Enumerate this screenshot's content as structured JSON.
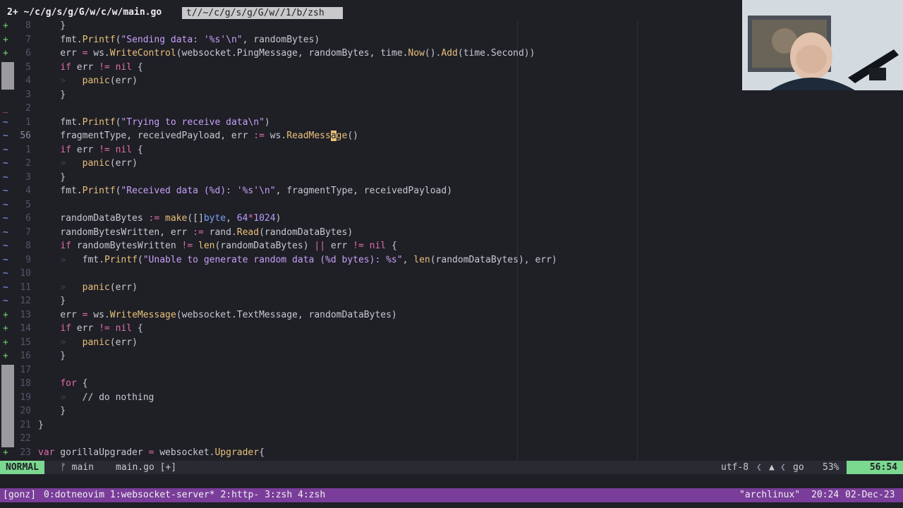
{
  "tabline": {
    "active": "2+ ~/c/g/s/g/G/w/c/w/main.go",
    "inactive": "t//~/c/g/s/g/G/w//1/b/zsh"
  },
  "lines": [
    {
      "sign": "+",
      "nr": "8",
      "code": [
        {
          "t": "    }",
          "c": "p"
        }
      ]
    },
    {
      "sign": "+",
      "nr": "7",
      "code": [
        {
          "t": "    fmt.",
          "c": "v"
        },
        {
          "t": "Printf",
          "c": "f"
        },
        {
          "t": "(",
          "c": "p"
        },
        {
          "t": "\"Sending data: '%s'\\n\"",
          "c": "s"
        },
        {
          "t": ", randomBytes)",
          "c": "v"
        }
      ]
    },
    {
      "sign": "+",
      "nr": "6",
      "code": [
        {
          "t": "    err ",
          "c": "v"
        },
        {
          "t": "=",
          "c": "o"
        },
        {
          "t": " ws.",
          "c": "v"
        },
        {
          "t": "WriteControl",
          "c": "f"
        },
        {
          "t": "(websocket.PingMessage, randomBytes, time.",
          "c": "v"
        },
        {
          "t": "Now",
          "c": "f"
        },
        {
          "t": "().",
          "c": "v"
        },
        {
          "t": "Add",
          "c": "f"
        },
        {
          "t": "(time.Second))",
          "c": "v"
        }
      ]
    },
    {
      "sign": "bar",
      "nr": "5",
      "code": [
        {
          "t": "    ",
          "c": "v"
        },
        {
          "t": "if",
          "c": "k"
        },
        {
          "t": " err ",
          "c": "v"
        },
        {
          "t": "!=",
          "c": "o"
        },
        {
          "t": " ",
          "c": "v"
        },
        {
          "t": "nil",
          "c": "k"
        },
        {
          "t": " {",
          "c": "p"
        }
      ]
    },
    {
      "sign": "bar",
      "nr": "4",
      "code": [
        {
          "t": "    ",
          "c": "v"
        },
        {
          "t": "»   ",
          "c": "gap"
        },
        {
          "t": "panic",
          "c": "f"
        },
        {
          "t": "(err)",
          "c": "v"
        }
      ]
    },
    {
      "sign": "",
      "nr": "3",
      "code": [
        {
          "t": "    }",
          "c": "p"
        }
      ]
    },
    {
      "sign": "del",
      "nr": "2",
      "code": []
    },
    {
      "sign": "~",
      "nr": "1",
      "code": [
        {
          "t": "    fmt.",
          "c": "v"
        },
        {
          "t": "Printf",
          "c": "f"
        },
        {
          "t": "(",
          "c": "p"
        },
        {
          "t": "\"Trying to receive data\\n\"",
          "c": "s"
        },
        {
          "t": ")",
          "c": "p"
        }
      ]
    },
    {
      "sign": "~",
      "nr": "56",
      "cur": true,
      "code": [
        {
          "t": "    fragmentType, receivedPayload, err ",
          "c": "v"
        },
        {
          "t": ":=",
          "c": "o"
        },
        {
          "t": " ws.",
          "c": "v"
        },
        {
          "t": "ReadMess",
          "c": "f"
        },
        {
          "t": "a",
          "c": "cursor"
        },
        {
          "t": "ge",
          "c": "f"
        },
        {
          "t": "()",
          "c": "v"
        }
      ]
    },
    {
      "sign": "~",
      "nr": "1",
      "code": [
        {
          "t": "    ",
          "c": "v"
        },
        {
          "t": "if",
          "c": "k"
        },
        {
          "t": " err ",
          "c": "v"
        },
        {
          "t": "!=",
          "c": "o"
        },
        {
          "t": " ",
          "c": "v"
        },
        {
          "t": "nil",
          "c": "k"
        },
        {
          "t": " {",
          "c": "p"
        }
      ]
    },
    {
      "sign": "~",
      "nr": "2",
      "code": [
        {
          "t": "    ",
          "c": "v"
        },
        {
          "t": "»   ",
          "c": "gap"
        },
        {
          "t": "panic",
          "c": "f"
        },
        {
          "t": "(err)",
          "c": "v"
        }
      ]
    },
    {
      "sign": "~",
      "nr": "3",
      "code": [
        {
          "t": "    }",
          "c": "p"
        }
      ]
    },
    {
      "sign": "~",
      "nr": "4",
      "code": [
        {
          "t": "    fmt.",
          "c": "v"
        },
        {
          "t": "Printf",
          "c": "f"
        },
        {
          "t": "(",
          "c": "p"
        },
        {
          "t": "\"Received data (%d): '%s'\\n\"",
          "c": "s"
        },
        {
          "t": ", fragmentType, receivedPayload)",
          "c": "v"
        }
      ]
    },
    {
      "sign": "~",
      "nr": "5",
      "code": []
    },
    {
      "sign": "~",
      "nr": "6",
      "code": [
        {
          "t": "    randomDataBytes ",
          "c": "v"
        },
        {
          "t": ":=",
          "c": "o"
        },
        {
          "t": " ",
          "c": "v"
        },
        {
          "t": "make",
          "c": "f"
        },
        {
          "t": "([]",
          "c": "v"
        },
        {
          "t": "byte",
          "c": "ty"
        },
        {
          "t": ", ",
          "c": "v"
        },
        {
          "t": "64",
          "c": "n"
        },
        {
          "t": "*",
          "c": "o"
        },
        {
          "t": "1024",
          "c": "n"
        },
        {
          "t": ")",
          "c": "v"
        }
      ]
    },
    {
      "sign": "~",
      "nr": "7",
      "code": [
        {
          "t": "    randomBytesWritten, err ",
          "c": "v"
        },
        {
          "t": ":=",
          "c": "o"
        },
        {
          "t": " rand.",
          "c": "v"
        },
        {
          "t": "Read",
          "c": "f"
        },
        {
          "t": "(randomDataBytes)",
          "c": "v"
        }
      ]
    },
    {
      "sign": "~",
      "nr": "8",
      "code": [
        {
          "t": "    ",
          "c": "v"
        },
        {
          "t": "if",
          "c": "k"
        },
        {
          "t": " randomBytesWritten ",
          "c": "v"
        },
        {
          "t": "!=",
          "c": "o"
        },
        {
          "t": " ",
          "c": "v"
        },
        {
          "t": "len",
          "c": "f"
        },
        {
          "t": "(randomDataBytes) ",
          "c": "v"
        },
        {
          "t": "||",
          "c": "o"
        },
        {
          "t": " err ",
          "c": "v"
        },
        {
          "t": "!=",
          "c": "o"
        },
        {
          "t": " ",
          "c": "v"
        },
        {
          "t": "nil",
          "c": "k"
        },
        {
          "t": " {",
          "c": "p"
        }
      ]
    },
    {
      "sign": "~",
      "nr": "9",
      "code": [
        {
          "t": "    ",
          "c": "v"
        },
        {
          "t": "»   ",
          "c": "gap"
        },
        {
          "t": "fmt.",
          "c": "v"
        },
        {
          "t": "Printf",
          "c": "f"
        },
        {
          "t": "(",
          "c": "p"
        },
        {
          "t": "\"Unable to generate random data (%d bytes): %s\"",
          "c": "s"
        },
        {
          "t": ", ",
          "c": "v"
        },
        {
          "t": "len",
          "c": "f"
        },
        {
          "t": "(randomDataBytes), err)",
          "c": "v"
        }
      ]
    },
    {
      "sign": "~",
      "nr": "10",
      "code": []
    },
    {
      "sign": "~",
      "nr": "11",
      "code": [
        {
          "t": "    ",
          "c": "v"
        },
        {
          "t": "»   ",
          "c": "gap"
        },
        {
          "t": "panic",
          "c": "f"
        },
        {
          "t": "(err)",
          "c": "v"
        }
      ]
    },
    {
      "sign": "~",
      "nr": "12",
      "code": [
        {
          "t": "    }",
          "c": "p"
        }
      ]
    },
    {
      "sign": "+",
      "nr": "13",
      "code": [
        {
          "t": "    err ",
          "c": "v"
        },
        {
          "t": "=",
          "c": "o"
        },
        {
          "t": " ws.",
          "c": "v"
        },
        {
          "t": "WriteMessage",
          "c": "f"
        },
        {
          "t": "(websocket.TextMessage, randomDataBytes)",
          "c": "v"
        }
      ]
    },
    {
      "sign": "+",
      "nr": "14",
      "code": [
        {
          "t": "    ",
          "c": "v"
        },
        {
          "t": "if",
          "c": "k"
        },
        {
          "t": " err ",
          "c": "v"
        },
        {
          "t": "!=",
          "c": "o"
        },
        {
          "t": " ",
          "c": "v"
        },
        {
          "t": "nil",
          "c": "k"
        },
        {
          "t": " {",
          "c": "p"
        }
      ]
    },
    {
      "sign": "+",
      "nr": "15",
      "code": [
        {
          "t": "    ",
          "c": "v"
        },
        {
          "t": "»   ",
          "c": "gap"
        },
        {
          "t": "panic",
          "c": "f"
        },
        {
          "t": "(err)",
          "c": "v"
        }
      ]
    },
    {
      "sign": "+",
      "nr": "16",
      "code": [
        {
          "t": "    }",
          "c": "p"
        }
      ]
    },
    {
      "sign": "bar",
      "nr": "17",
      "code": []
    },
    {
      "sign": "bar",
      "nr": "18",
      "code": [
        {
          "t": "    ",
          "c": "v"
        },
        {
          "t": "for",
          "c": "k"
        },
        {
          "t": " {",
          "c": "p"
        }
      ]
    },
    {
      "sign": "bar",
      "nr": "19",
      "code": [
        {
          "t": "    ",
          "c": "v"
        },
        {
          "t": "»   ",
          "c": "gap"
        },
        {
          "t": "// do nothing",
          "c": "cm"
        }
      ]
    },
    {
      "sign": "bar",
      "nr": "20",
      "code": [
        {
          "t": "    }",
          "c": "p"
        }
      ]
    },
    {
      "sign": "bar",
      "nr": "21",
      "code": [
        {
          "t": "}",
          "c": "p"
        }
      ]
    },
    {
      "sign": "bar",
      "nr": "22",
      "code": []
    },
    {
      "sign": "+",
      "nr": "23",
      "code": [
        {
          "t": "var",
          "c": "k"
        },
        {
          "t": " gorillaUpgrader ",
          "c": "v"
        },
        {
          "t": "=",
          "c": "o"
        },
        {
          "t": " websocket.",
          "c": "v"
        },
        {
          "t": "Upgrader",
          "c": "f"
        },
        {
          "t": "{",
          "c": "p"
        }
      ]
    }
  ],
  "statusline": {
    "mode": "NORMAL",
    "branch": "ᚠ main",
    "file": "main.go [+]",
    "encoding": "utf-8",
    "os_icon": "arch-icon",
    "filetype": "go",
    "percent": "53%",
    "position": "56:54"
  },
  "tmux": {
    "session": "[gonz]",
    "windows": "0:dotneovim  1:websocket-server* 2:http- 3:zsh  4:zsh",
    "host": "\"archlinux\"",
    "time": "20:24",
    "date": "02-Dec-23"
  },
  "colors": {
    "background": "#1f1f26",
    "mode_bg": "#7bd88f",
    "tmux_bg": "#7a3d9a"
  }
}
